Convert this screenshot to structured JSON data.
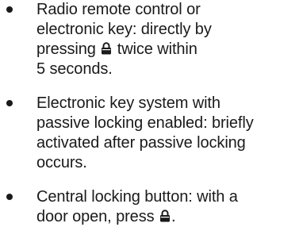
{
  "bullets": [
    {
      "lines": [
        "Radio remote control or",
        "electronic key: directly by",
        "pressing",
        "twice within",
        "5 seconds."
      ]
    },
    {
      "lines": [
        "Electronic key system with",
        "passive locking enabled: briefly",
        "activated after passive locking",
        "occurs."
      ]
    },
    {
      "lines": [
        "Central locking button: with a",
        "door open, press",
        "."
      ]
    }
  ],
  "icons": {
    "lock": "padlock-icon"
  },
  "colors": {
    "text": "#1a1a1a",
    "background": "#ffffff"
  }
}
